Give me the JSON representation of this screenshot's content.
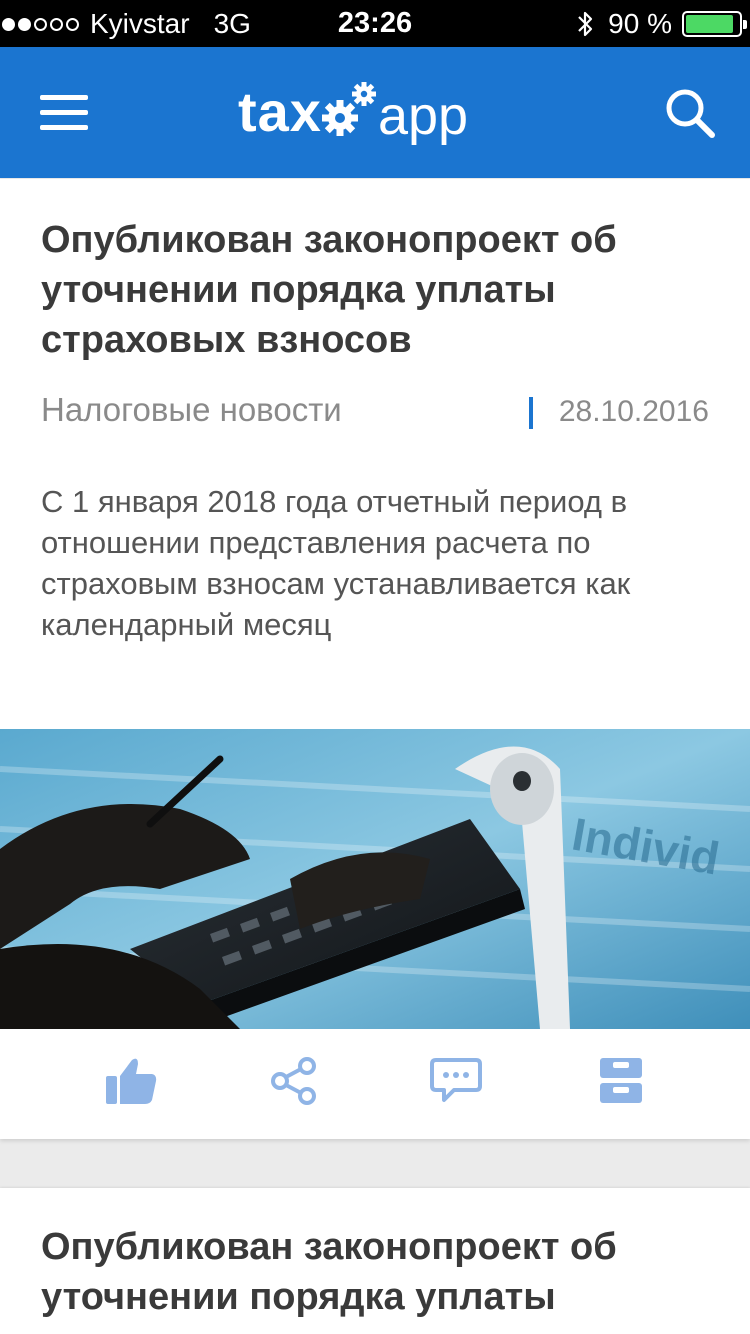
{
  "status_bar": {
    "carrier": "Kyivstar",
    "network": "3G",
    "time": "23:26",
    "battery": "90 %",
    "battery_level": 0.9,
    "signal_bars_filled": 2,
    "signal_bars_total": 5
  },
  "header": {
    "logo_left": "tax",
    "logo_right": "app",
    "icons": [
      "menu-icon",
      "search-icon"
    ],
    "color": "#1b75d0"
  },
  "articles": [
    {
      "title": "Опубликован законопроект об уточнении порядка уплаты страховых взносов",
      "category": "Налоговые новости",
      "date": "28.10.2016",
      "summary": "С 1 января 2018 года отчетный период в отношении представления расчета по страховым взносам устанавливается как календарный месяц",
      "actions": [
        "like-icon",
        "share-icon",
        "comment-icon",
        "archive-icon"
      ]
    },
    {
      "title": "Опубликован законопроект об уточнении порядка уплаты"
    }
  ],
  "colors": {
    "accent": "#1b75d0",
    "action_icon": "#8fb4e6",
    "battery": "#4cd964"
  }
}
